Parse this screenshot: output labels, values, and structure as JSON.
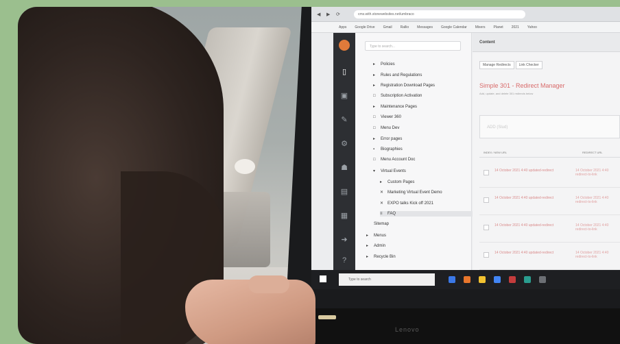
{
  "browser": {
    "url": "cms.with.stonewebsites.net/umbraco",
    "bookmarks": [
      "Apps",
      "Google Drive",
      "Gmail",
      "Rallio",
      "Messages",
      "Google Calendar",
      "Mixers",
      "Planet",
      "2021",
      "Yahoo"
    ]
  },
  "cms": {
    "search_placeholder": "Type to search...",
    "tree": [
      {
        "glyph": "▸",
        "label": "Policies",
        "indent": 1
      },
      {
        "glyph": "▸",
        "label": "Rules and Regulations",
        "indent": 1
      },
      {
        "glyph": "▸",
        "label": "Registration Download Pages",
        "indent": 1
      },
      {
        "glyph": "□",
        "label": "Subscription Activation",
        "indent": 1
      },
      {
        "glyph": "▸",
        "label": "Maintenance Pages",
        "indent": 1
      },
      {
        "glyph": "□",
        "label": "Viewer 360",
        "indent": 1
      },
      {
        "glyph": "□",
        "label": "Menu Dev",
        "indent": 1
      },
      {
        "glyph": "▸",
        "label": "Error pages",
        "indent": 1
      },
      {
        "glyph": "▪",
        "label": "Biographies",
        "indent": 1
      },
      {
        "glyph": "□",
        "label": "Menu Account Doc",
        "indent": 1
      },
      {
        "glyph": "▾",
        "label": "Virtual Events",
        "indent": 1
      },
      {
        "glyph": "▸",
        "label": "Custom Pages",
        "indent": 2
      },
      {
        "glyph": "✕",
        "label": "Marketing Virtual Event Demo",
        "indent": 2
      },
      {
        "glyph": "✕",
        "label": "EXPO talks Kick off 2021",
        "indent": 2
      },
      {
        "glyph": "≡",
        "label": "FAQ",
        "indent": 2,
        "selected": true
      },
      {
        "glyph": "",
        "label": "Sitemap",
        "indent": 0
      },
      {
        "glyph": "▸",
        "label": "Menus",
        "indent": 0
      },
      {
        "glyph": "▸",
        "label": "Admin",
        "indent": 0
      },
      {
        "glyph": "▸",
        "label": "Recycle Bin",
        "indent": 0
      }
    ],
    "content_header": "Content",
    "tabs": [
      "Manage Redirects",
      "Link Checker"
    ],
    "title": "Simple 301 - Redirect Manager",
    "subtitle": "Add, update, and delete 301 redirects below",
    "add_placeholder": "ADD (Slud)",
    "table_headers": [
      "INDEX / NEW URL",
      "REDIRECT URL"
    ],
    "rows": [
      {
        "a": "14 October 2021 4:40 updated-redirect",
        "b": "14 October 2021 4:40 redirect-to-link"
      },
      {
        "a": "14 October 2021 4:40 updated-redirect",
        "b": "14 October 2021 4:40 redirect-to-link"
      },
      {
        "a": "14 October 2021 4:40 updated-redirect",
        "b": "14 October 2021 4:40 redirect-to-link"
      },
      {
        "a": "14 October 2021 4:40 updated-redirect",
        "b": "14 October 2021 4:40 redirect-to-link"
      }
    ]
  },
  "taskbar": {
    "search_placeholder": "Type to search"
  },
  "laptop": {
    "brand": "Lenovo"
  },
  "colors": {
    "frame_bg": "#9bbf8e",
    "accent_title": "#d86a6a",
    "cms_rail": "#2d2f33"
  }
}
